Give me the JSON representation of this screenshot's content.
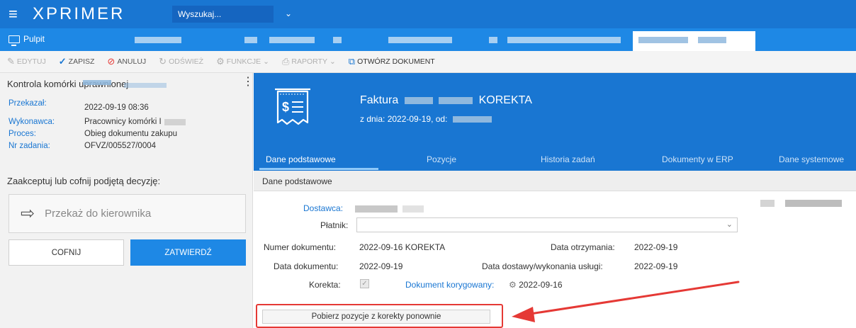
{
  "app": {
    "menu_icon": "hamburger-icon",
    "logo": "XPRIMER",
    "search_label": "Wyszukaj...",
    "search_chevron": "chevron-down-icon"
  },
  "tabs": {
    "home_label": "Pulpit",
    "home_icon": "monitor-icon"
  },
  "toolbar": {
    "edit": "EDYTUJ",
    "save": "ZAPISZ",
    "cancel": "ANULUJ",
    "refresh": "ODŚWIEŻ",
    "functions": "FUNKCJE",
    "reports": "RAPORTY",
    "open_document": "OTWÓRZ DOKUMENT"
  },
  "left": {
    "title": "Kontrola komórki uprawnionej",
    "fields": [
      {
        "label": "Przekazał:",
        "value": "2022-09-19 08:36"
      },
      {
        "label": "Wykonawca:",
        "value": "Pracownicy komórki I"
      },
      {
        "label": "Proces:",
        "value": "Obieg dokumentu zakupu"
      },
      {
        "label": "Nr zadania:",
        "value": "OFVZ/005527/0004"
      }
    ],
    "question": "Zaakceptuj lub cofnij podjętą decyzję:",
    "forward": "Przekaż do kierownika",
    "back_button": "COFNIJ",
    "confirm_button": "ZATWIERDŹ"
  },
  "document": {
    "title_prefix": "Faktura",
    "title_suffix": "KOREKTA",
    "subtitle": "z dnia: 2022-09-19, od:",
    "tabs": [
      "Dane podstawowe",
      "Pozycje",
      "Historia zadań",
      "Dokumenty w ERP",
      "Dane systemowe"
    ],
    "active_tab": "Dane podstawowe",
    "section_title": "Dane podstawowe"
  },
  "form": {
    "supplier_label": "Dostawca:",
    "payer_label": "Płatnik:",
    "payer_value": "",
    "doc_number_label": "Numer dokumentu:",
    "doc_number_value": "2022-09-16 KOREKTA",
    "received_label": "Data otrzymania:",
    "received_value": "2022-09-19",
    "doc_date_label": "Data dokumentu:",
    "doc_date_value": "2022-09-19",
    "delivery_label": "Data dostawy/wykonania usługi:",
    "delivery_value": "2022-09-19",
    "correction_label": "Korekta:",
    "corrected_doc_label": "Dokument korygowany:",
    "corrected_doc_value": "2022-09-16",
    "fetch_button": "Pobierz pozycje z korekty ponownie"
  },
  "colors": {
    "primary": "#1976d2",
    "tab_strip": "#1e88e5",
    "highlight": "#e53935"
  }
}
